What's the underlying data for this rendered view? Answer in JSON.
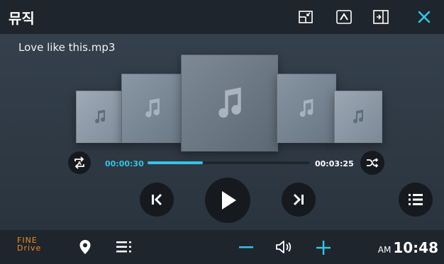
{
  "header": {
    "title": "뮤직",
    "buttons": [
      {
        "icon": "minimize-window-icon"
      },
      {
        "icon": "collapse-up-icon"
      },
      {
        "icon": "split-view-icon"
      },
      {
        "icon": "close-icon"
      }
    ],
    "accent": "#34c3e6"
  },
  "track": {
    "filename": "Love like this.mp3",
    "elapsed": "00:00:30",
    "duration": "00:03:25",
    "progress_fraction": 0.34
  },
  "album_icons": [
    "music-note-icon"
  ],
  "controls": {
    "repeat_icon": "repeat-a-icon",
    "shuffle_icon": "shuffle-icon",
    "previous_icon": "skip-previous-icon",
    "play_icon": "play-icon",
    "next_icon": "skip-next-icon",
    "playlist_icon": "playlist-icon"
  },
  "bottombar": {
    "brand_line1": "FINE",
    "brand_line2": "Drive",
    "brand_color": "#f08a24",
    "location_icon": "location-pin-icon",
    "menu_icon": "menu-icon",
    "volume_down_icon": "minus-icon",
    "volume_icon": "speaker-icon",
    "volume_up_icon": "plus-icon",
    "ampm": "AM",
    "time": "10:48"
  }
}
